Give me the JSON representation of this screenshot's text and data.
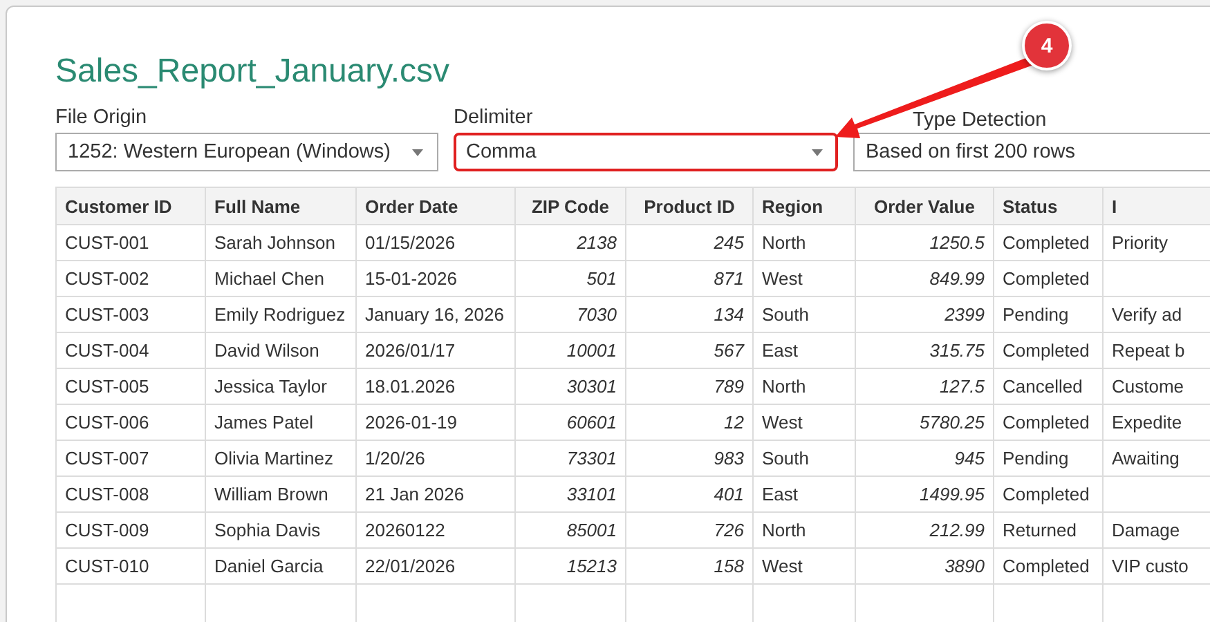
{
  "title": "Sales_Report_January.csv",
  "options": [
    {
      "label": "File Origin",
      "value": "1252: Western European (Windows)",
      "highlighted": false,
      "dropdown": true
    },
    {
      "label": "Delimiter",
      "value": "Comma",
      "highlighted": true,
      "dropdown": true
    },
    {
      "label": "Type Detection",
      "value": "Based on first 200 rows",
      "highlighted": false
    }
  ],
  "callout": {
    "number": "4"
  },
  "table": {
    "columns": [
      {
        "name": "Customer ID",
        "kind": "text"
      },
      {
        "name": "Full Name",
        "kind": "text"
      },
      {
        "name": "Order Date",
        "kind": "text"
      },
      {
        "name": "ZIP Code",
        "kind": "number"
      },
      {
        "name": "Product ID",
        "kind": "number"
      },
      {
        "name": "Region",
        "kind": "text"
      },
      {
        "name": "Order Value",
        "kind": "number"
      },
      {
        "name": "Status",
        "kind": "text"
      },
      {
        "name": "I",
        "kind": "text"
      }
    ],
    "rows": [
      [
        "CUST-001",
        "Sarah Johnson",
        "01/15/2026",
        "2138",
        "245",
        "North",
        "1250.5",
        "Completed",
        "Priority"
      ],
      [
        "CUST-002",
        "Michael Chen",
        "15-01-2026",
        "501",
        "871",
        "West",
        "849.99",
        "Completed",
        null
      ],
      [
        "CUST-003",
        "Emily Rodriguez",
        "January 16, 2026",
        "7030",
        "134",
        "South",
        "2399",
        "Pending",
        "Verify ad"
      ],
      [
        "CUST-004",
        "David Wilson",
        "2026/01/17",
        "10001",
        "567",
        "East",
        "315.75",
        "Completed",
        "Repeat b"
      ],
      [
        "CUST-005",
        "Jessica Taylor",
        "18.01.2026",
        "30301",
        "789",
        "North",
        "127.5",
        "Cancelled",
        "Custome"
      ],
      [
        "CUST-006",
        "James Patel",
        "2026-01-19",
        "60601",
        "12",
        "West",
        "5780.25",
        "Completed",
        "Expedite"
      ],
      [
        "CUST-007",
        "Olivia Martinez",
        "1/20/26",
        "73301",
        "983",
        "South",
        "945",
        "Pending",
        "Awaiting"
      ],
      [
        "CUST-008",
        "William Brown",
        "21 Jan 2026",
        "33101",
        "401",
        "East",
        "1499.95",
        "Completed",
        null
      ],
      [
        "CUST-009",
        "Sophia Davis",
        "20260122",
        "85001",
        "726",
        "North",
        "212.99",
        "Returned",
        "Damage"
      ],
      [
        "CUST-010",
        "Daniel Garcia",
        "22/01/2026",
        "15213",
        "158",
        "West",
        "3890",
        "Completed",
        "VIP custo"
      ]
    ]
  }
}
